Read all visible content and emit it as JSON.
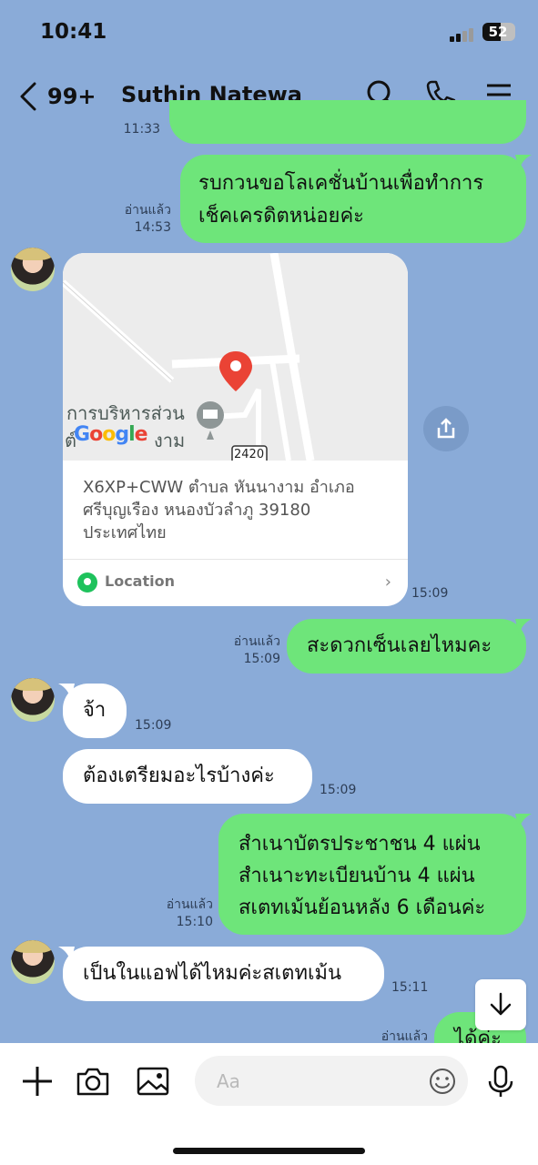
{
  "status_bar": {
    "time": "10:41",
    "battery": "52"
  },
  "header": {
    "back_count": "99+",
    "contact_name": "Suthin Natewa"
  },
  "partial_top": {
    "time": "11:33"
  },
  "messages": {
    "m1": {
      "text_line1": "รบกวนขอโลเคชั่นบ้านเพื่อทำการ",
      "text_line2": "เช็คเครดิตหน่อยค่ะ",
      "read": "อ่านแล้ว",
      "time": "14:53"
    },
    "location": {
      "map_place_label": "การบริหารส่วน",
      "map_place_label2": "ต์",
      "map_place_label3": "งาม",
      "map_brand": "Google",
      "road_number": "2420",
      "address_line1": "X6XP+CWW ตำบล หันนางาม อำเภอ",
      "address_line2": "ศรีบุญเรือง หนองบัวลำภู 39180",
      "address_line3": "ประเทศไทย",
      "label": "Location",
      "time": "15:09"
    },
    "m2": {
      "text": "สะดวกเซ็นเลยไหมคะ",
      "read": "อ่านแล้ว",
      "time": "15:09"
    },
    "m3": {
      "text": "จ้า",
      "time": "15:09"
    },
    "m4": {
      "text": "ต้องเตรียมอะไรบ้างค่ะ",
      "time": "15:09"
    },
    "m5": {
      "text_line1": "สำเนาบัตรประชาชน 4 แผ่น",
      "text_line2": "สำเนาะทะเบียนบ้าน 4 แผ่น",
      "text_line3": "สเตทเม้นย้อนหลัง 6 เดือนค่ะ",
      "read": "อ่านแล้ว",
      "time": "15:10"
    },
    "m6": {
      "text": "เป็นในแอฟได้ไหมค่ะสเตทเม้น",
      "time": "15:11"
    },
    "m7": {
      "text": "ได้ค่ะ",
      "read": "อ่านแล้ว"
    }
  },
  "composer": {
    "placeholder": "Aa"
  },
  "colors": {
    "background": "#8aabd8",
    "outgoing": "#6ee57a",
    "incoming": "#ffffff"
  }
}
